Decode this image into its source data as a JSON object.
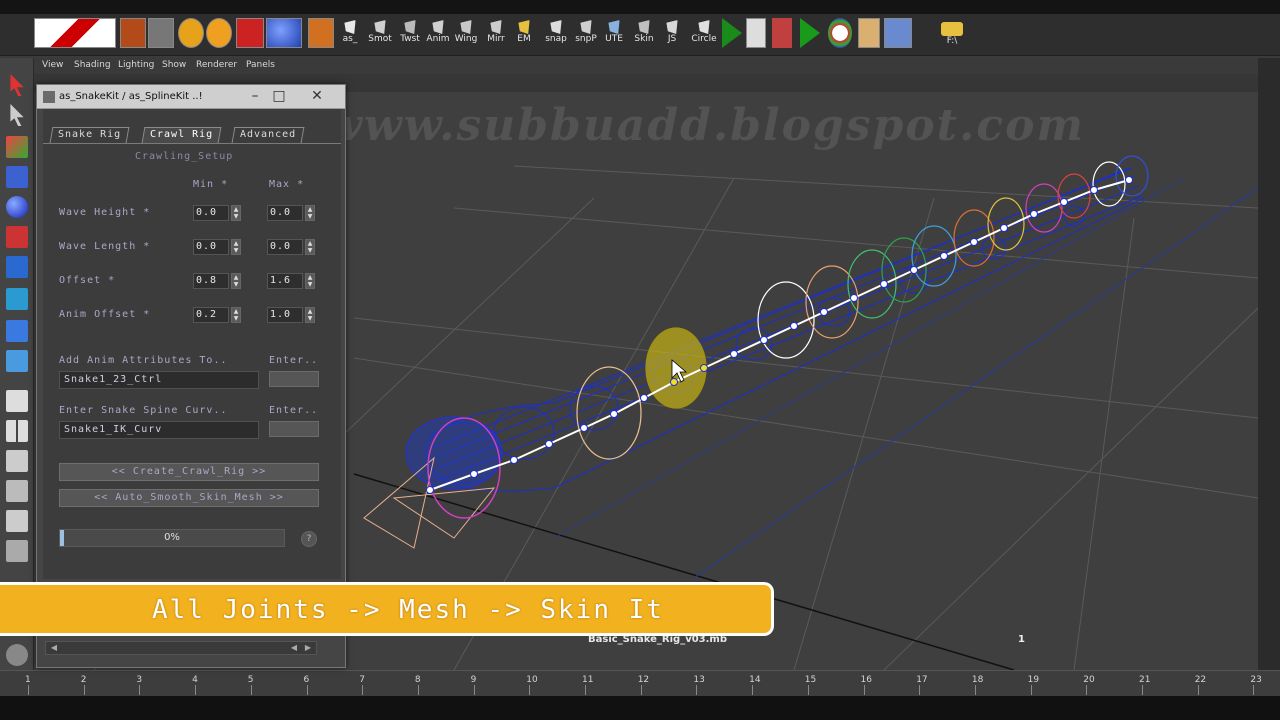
{
  "shelf": {
    "buttons": [
      {
        "label": "as_",
        "icon": "script-icon"
      },
      {
        "label": "Smot",
        "icon": "smooth-icon"
      },
      {
        "label": "Twst",
        "icon": "twist-icon"
      },
      {
        "label": "Anim",
        "icon": "anim-icon"
      },
      {
        "label": "Wing",
        "icon": "wing-icon"
      },
      {
        "label": "Mirr",
        "icon": "mirror-icon"
      },
      {
        "label": "EM",
        "icon": "folder-icon"
      },
      {
        "label": "snap",
        "icon": "snap-icon"
      },
      {
        "label": "snpP",
        "icon": "snap-point-icon"
      },
      {
        "label": "UTE",
        "icon": "window-icon"
      },
      {
        "label": "Skin",
        "icon": "skin-icon"
      },
      {
        "label": "JS",
        "icon": "joint-script-icon"
      },
      {
        "label": "Circle",
        "icon": "circle-icon"
      }
    ],
    "drive_label": "F:\\"
  },
  "viewport": {
    "menu": [
      "View",
      "Shading",
      "Lighting",
      "Show",
      "Renderer",
      "Panels"
    ],
    "watermark": "www.subbuadd.blogspot.com",
    "filename": "Basic_Snake_Rig_v03.mb",
    "frame": "1"
  },
  "window": {
    "title": "as_SnakeKit / as_SplineKit ..!",
    "tabs": [
      "Snake Rig",
      "Crawl Rig",
      "Advanced"
    ],
    "active_tab": "Crawl Rig",
    "section_title": "Crawling_Setup",
    "col_min": "Min *",
    "col_max": "Max *",
    "rows": [
      {
        "label": "Wave Height *",
        "min": "0.0",
        "max": "0.0"
      },
      {
        "label": "Wave Length *",
        "min": "0.0",
        "max": "0.0"
      },
      {
        "label": "Offset *",
        "min": "0.8",
        "max": "1.6"
      },
      {
        "label": "Anim Offset *",
        "min": "0.2",
        "max": "1.0"
      }
    ],
    "anim_attr_label": "Add Anim Attributes To..",
    "anim_attr_value": "Snake1_23_Ctrl",
    "enter_label_1": "Enter..",
    "spine_curve_label": "Enter Snake Spine Curv..",
    "spine_curve_value": "Snake1_IK_Curv",
    "enter_label_2": "Enter..",
    "create_button": "<< Create_Crawl_Rig >>",
    "smooth_button": "<< Auto_Smooth_Skin_Mesh >>",
    "progress_text": "0%",
    "progress": 0.02
  },
  "caption": "All Joints -> Mesh -> Skin It",
  "timeline": {
    "ticks": [
      "1",
      "2",
      "3",
      "4",
      "5",
      "6",
      "7",
      "8",
      "9",
      "10",
      "11",
      "12",
      "13",
      "14",
      "15",
      "16",
      "17",
      "18",
      "19",
      "20",
      "21",
      "22",
      "23"
    ]
  },
  "colors": {
    "caption_bg": "#f2b11f",
    "wire_blue": "#1a2fd0",
    "joint_white": "#ffffff",
    "label_lilac": "#a8a8c8"
  }
}
